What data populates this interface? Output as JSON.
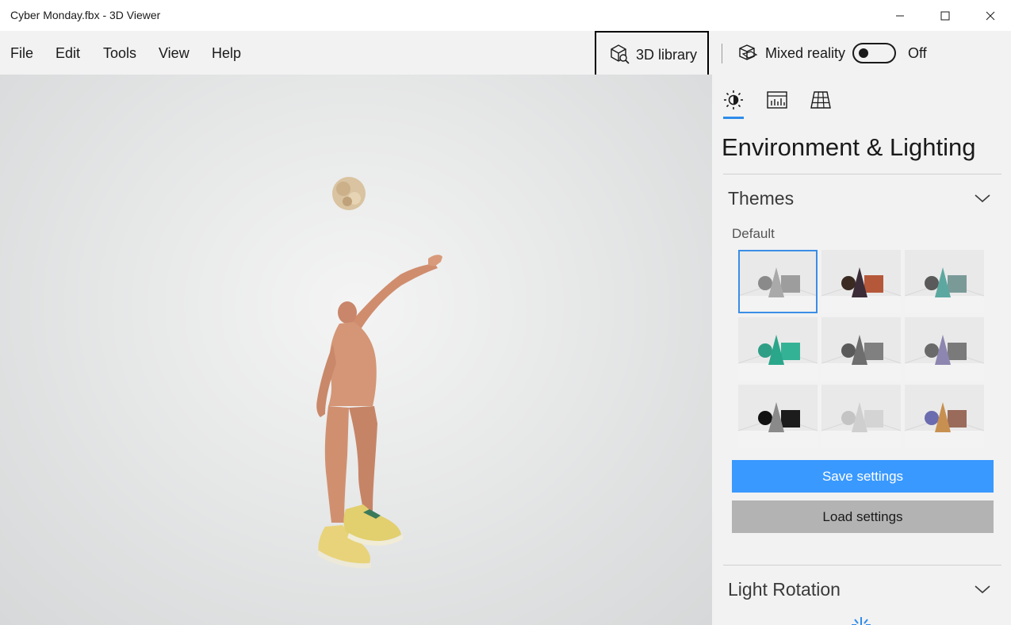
{
  "window": {
    "title": "Cyber Monday.fbx - 3D Viewer",
    "controls": {
      "minimize_icon": "minimize-icon",
      "maximize_icon": "maximize-icon",
      "close_icon": "close-icon"
    }
  },
  "menu": {
    "items": [
      "File",
      "Edit",
      "Tools",
      "View",
      "Help"
    ],
    "library_label": "3D library",
    "mixed_reality_label": "Mixed reality",
    "toggle_state": "Off"
  },
  "panel": {
    "tabs": [
      "sun-icon",
      "stats-icon",
      "grid-icon"
    ],
    "active_tab": 0,
    "title": "Environment & Lighting",
    "themes": {
      "heading": "Themes",
      "subheading": "Default",
      "selected_index": 0,
      "items": [
        {
          "sphere": "#8a8a8a",
          "cone": "#a9a9a9",
          "box": "#9d9d9d"
        },
        {
          "sphere": "#3a2a22",
          "cone": "#3c2c38",
          "box": "#b5583a"
        },
        {
          "sphere": "#5a5a5a",
          "cone": "#5ca8a0",
          "box": "#7a9a98"
        },
        {
          "sphere": "#2f9e86",
          "cone": "#2aa68a",
          "box": "#34b296"
        },
        {
          "sphere": "#5a5a5a",
          "cone": "#6e6e6e",
          "box": "#808080"
        },
        {
          "sphere": "#6a6a6a",
          "cone": "#8c86b0",
          "box": "#7a7a7a"
        },
        {
          "sphere": "#111111",
          "cone": "#8a8a8a",
          "box": "#1c1c1c"
        },
        {
          "sphere": "#c4c4c4",
          "cone": "#cfcfcf",
          "box": "#d4d4d4"
        },
        {
          "sphere": "#6b6bb0",
          "cone": "#c89050",
          "box": "#9a6a5a"
        }
      ]
    },
    "save_label": "Save settings",
    "load_label": "Load settings",
    "light_rotation_heading": "Light Rotation"
  },
  "colors": {
    "accent": "#3a99ff",
    "selected_outline": "#3a8ee6",
    "tab_underline": "#2d8ceb"
  }
}
